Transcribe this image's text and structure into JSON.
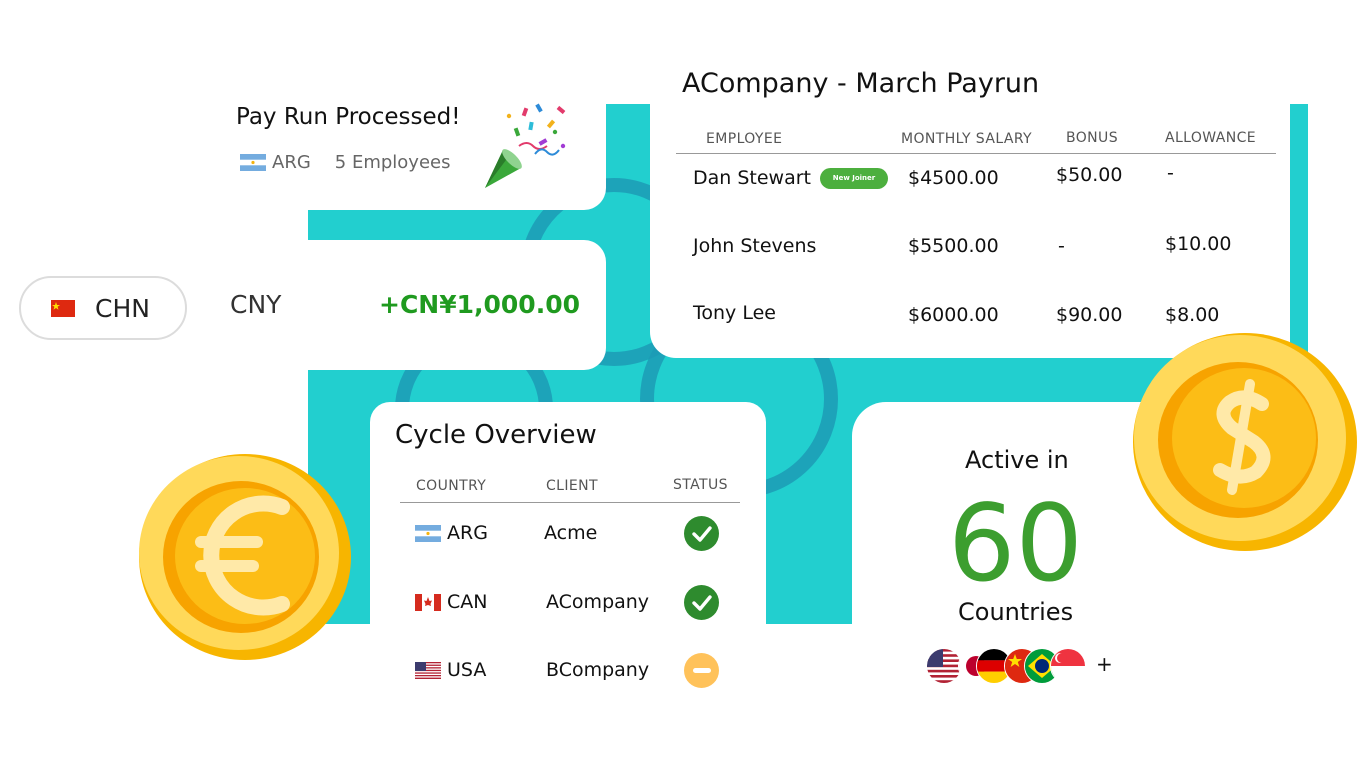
{
  "pay_run": {
    "title": "Pay Run Processed!",
    "country": "ARG",
    "employees": "5 Employees",
    "confetti_icon": "party-popper-icon"
  },
  "conversion": {
    "country": "CHN",
    "currency": "CNY",
    "amount": "+CN¥1,000.00"
  },
  "payrun_table": {
    "title": "ACompany - March Payrun",
    "columns": [
      "EMPLOYEE",
      "MONTHLY SALARY",
      "BONUS",
      "ALLOWANCE"
    ],
    "rows": [
      {
        "employee": "Dan Stewart",
        "badge": "New Joiner",
        "salary": "$4500.00",
        "bonus": "$50.00",
        "allowance": "-"
      },
      {
        "employee": "John Stevens",
        "badge": "",
        "salary": "$5500.00",
        "bonus": "-",
        "allowance": "$10.00"
      },
      {
        "employee": "Tony Lee",
        "badge": "",
        "salary": "$6000.00",
        "bonus": "$90.00",
        "allowance": "$8.00"
      }
    ]
  },
  "cycle_overview": {
    "title": "Cycle Overview",
    "columns": [
      "COUNTRY",
      "CLIENT",
      "STATUS"
    ],
    "rows": [
      {
        "country": "ARG",
        "client": "Acme",
        "status": "complete"
      },
      {
        "country": "CAN",
        "client": "ACompany",
        "status": "complete"
      },
      {
        "country": "USA",
        "client": "BCompany",
        "status": "pending"
      }
    ]
  },
  "active": {
    "label": "Active in",
    "count": "60",
    "unit": "Countries",
    "more": "+",
    "flags": [
      "usa-flag-icon",
      "japan-flag-icon",
      "germany-flag-icon",
      "china-flag-icon",
      "brazil-flag-icon",
      "singapore-flag-icon"
    ]
  },
  "colors": {
    "teal": "#22cfcf",
    "green": "#3c9e2f",
    "amount_green": "#1f9a1f",
    "badge_green": "#4caf3e",
    "pending_yellow": "#ffc25a",
    "coin_gold": "#f7b500"
  },
  "coins": [
    "euro-coin-icon",
    "dollar-coin-icon"
  ]
}
